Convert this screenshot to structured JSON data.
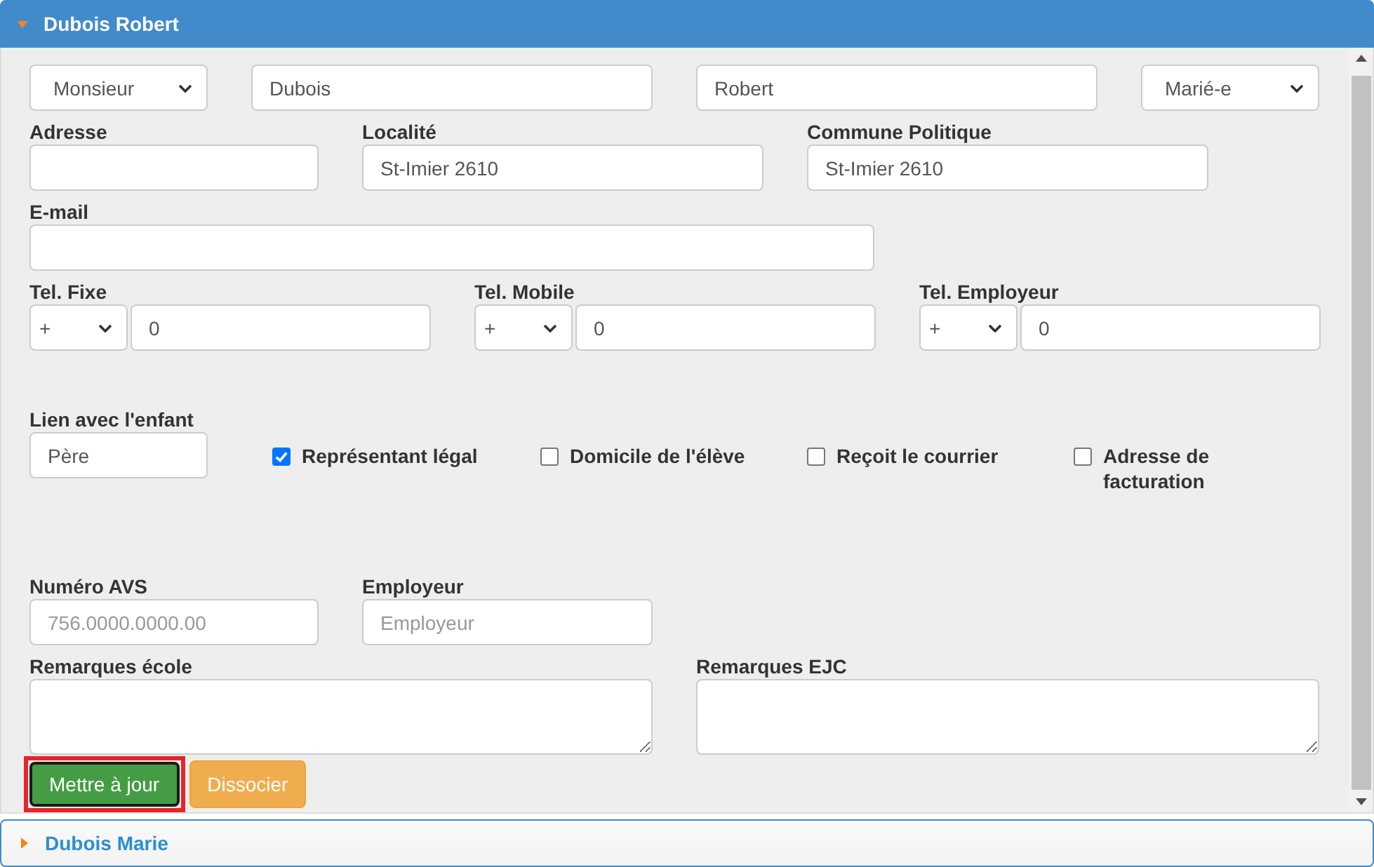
{
  "panels": [
    {
      "title": "Dubois Robert",
      "expanded": true
    },
    {
      "title": "Dubois Marie",
      "expanded": false
    }
  ],
  "form": {
    "rows": [
      {
        "fields": [
          {
            "kind": "select",
            "value": "Monsieur"
          },
          {
            "kind": "input",
            "value": "Dubois"
          },
          {
            "kind": "input",
            "value": "Robert"
          },
          {
            "kind": "select",
            "value": "Marié-e"
          }
        ]
      },
      {
        "fields": [
          {
            "kind": "input",
            "label": "Adresse"
          },
          {
            "kind": "input",
            "label": "Localité",
            "value": "St-Imier 2610"
          },
          {
            "kind": "input",
            "label": "Commune Politique",
            "value": "St-Imier 2610"
          }
        ]
      },
      {
        "fields": [
          {
            "kind": "input",
            "label": "E-mail"
          }
        ]
      },
      {
        "fields": [
          {
            "kind": "phone",
            "label": "Tel. Fixe",
            "prefix": "+",
            "value": "0"
          },
          {
            "kind": "phone",
            "label": "Tel. Mobile",
            "prefix": "+",
            "value": "0"
          },
          {
            "kind": "phone",
            "label": "Tel. Employeur",
            "prefix": "+",
            "value": "0"
          }
        ]
      },
      {
        "fields": [
          {
            "kind": "input",
            "label": "Lien avec l'enfant",
            "value": "Père"
          },
          {
            "kind": "checkbox",
            "label": "Représentant légal",
            "checked": true
          },
          {
            "kind": "checkbox",
            "label": "Domicile de l'élève",
            "checked": false
          },
          {
            "kind": "checkbox",
            "label": "Reçoit le courrier",
            "checked": false
          },
          {
            "kind": "checkbox",
            "label": "Adresse de facturation",
            "checked": false
          }
        ]
      },
      {
        "fields": [
          {
            "kind": "input",
            "label": "Numéro AVS",
            "placeholder": "756.0000.0000.00"
          },
          {
            "kind": "input",
            "label": "Employeur",
            "placeholder": "Employeur"
          }
        ]
      },
      {
        "fields": [
          {
            "kind": "textarea",
            "label": "Remarques école"
          },
          {
            "kind": "textarea",
            "label": "Remarques EJC"
          }
        ]
      }
    ],
    "buttons": [
      {
        "label": "Mettre à jour",
        "kind": "primary",
        "highlighted": true
      },
      {
        "label": "Dissocier",
        "kind": "warning",
        "highlighted": false
      }
    ]
  }
}
